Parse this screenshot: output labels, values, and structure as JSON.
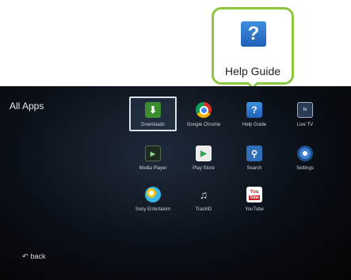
{
  "callout": {
    "label": "Help Guide",
    "icon": "question-mark-icon",
    "accent": "#8dc63f"
  },
  "screen": {
    "title": "All Apps",
    "back_label": "back",
    "back_icon": "back-arrow-icon"
  },
  "apps": [
    {
      "label": "Downloads",
      "icon": "download-icon",
      "glyph": "⬇",
      "selected": true
    },
    {
      "label": "Google Chrome",
      "icon": "chrome-icon",
      "glyph": "",
      "selected": false
    },
    {
      "label": "Help Guide",
      "icon": "question-mark-icon",
      "glyph": "?",
      "selected": false
    },
    {
      "label": "Live TV",
      "icon": "tv-icon",
      "glyph": "tv",
      "selected": false
    },
    {
      "label": "Media Player",
      "icon": "media-player-icon",
      "glyph": "▶",
      "selected": false
    },
    {
      "label": "Play Store",
      "icon": "play-store-icon",
      "glyph": "▶",
      "selected": false
    },
    {
      "label": "Search",
      "icon": "search-icon",
      "glyph": "🔍",
      "selected": false
    },
    {
      "label": "Settings",
      "icon": "settings-icon",
      "glyph": "",
      "selected": false
    },
    {
      "label": "Sony Entertainm",
      "icon": "sony-entertainment-icon",
      "glyph": "",
      "selected": false
    },
    {
      "label": "TrackID",
      "icon": "trackid-icon",
      "glyph": "♪",
      "selected": false
    },
    {
      "label": "YouTube",
      "icon": "youtube-icon",
      "glyph": "You",
      "selected": false
    }
  ]
}
